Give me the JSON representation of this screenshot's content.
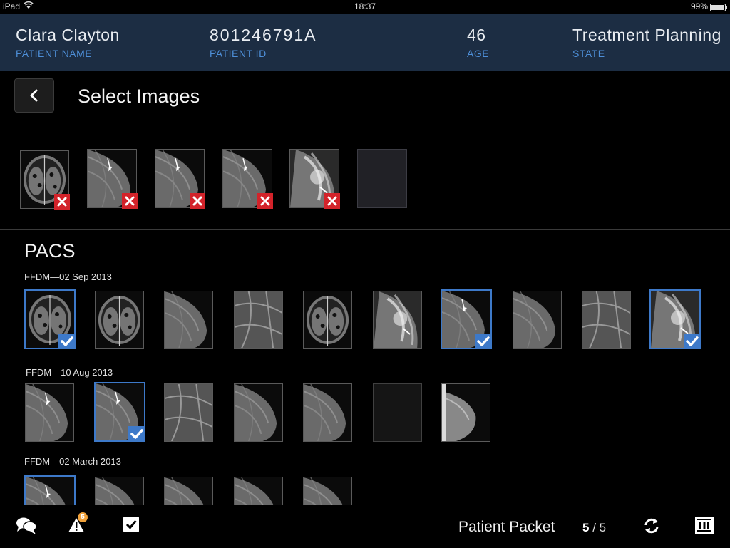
{
  "status_bar": {
    "carrier": "iPad",
    "time": "18:37",
    "battery": "99%"
  },
  "patient": {
    "name": "Clara Clayton",
    "name_label": "PATIENT NAME",
    "id": "801246791A",
    "id_label": "PATIENT ID",
    "age": "46",
    "age_label": "AGE",
    "state": "Treatment Planning",
    "state_label": "STATE"
  },
  "title": "Select Images",
  "selected_images": [
    "breast-axial-mri",
    "mammogram-arrow",
    "mammogram-arrow",
    "mammogram-arrow",
    "mammogram-dense",
    "empty"
  ],
  "pacs": {
    "title": "PACS",
    "groups": [
      {
        "label": "FFDM—02 Sep 2013",
        "images": [
          {
            "kind": "breast-axial-mri",
            "selected": true
          },
          {
            "kind": "breast-axial-mri",
            "selected": false
          },
          {
            "kind": "mammogram",
            "selected": false
          },
          {
            "kind": "mammogram-tissue",
            "selected": false
          },
          {
            "kind": "breast-axial-mri",
            "selected": false
          },
          {
            "kind": "mammogram-dense",
            "selected": false
          },
          {
            "kind": "mammogram-arrow",
            "selected": true
          },
          {
            "kind": "mammogram",
            "selected": false
          },
          {
            "kind": "mammogram-tissue",
            "selected": false
          },
          {
            "kind": "mammogram-dense",
            "selected": true
          }
        ]
      },
      {
        "label": "FFDM—10 Aug 2013",
        "images": [
          {
            "kind": "mammogram-arrow",
            "selected": false
          },
          {
            "kind": "mammogram-arrow",
            "selected": true
          },
          {
            "kind": "mammogram-tissue",
            "selected": false
          },
          {
            "kind": "mammogram",
            "selected": false
          },
          {
            "kind": "mammogram",
            "selected": false
          },
          {
            "kind": "empty",
            "selected": false
          },
          {
            "kind": "mammogram-lateral",
            "selected": false
          }
        ]
      },
      {
        "label": "FFDM—02 March 2013",
        "images": [
          {
            "kind": "mammogram-arrow",
            "selected": true
          },
          {
            "kind": "mammogram",
            "selected": false
          },
          {
            "kind": "mammogram",
            "selected": false
          },
          {
            "kind": "mammogram",
            "selected": false
          },
          {
            "kind": "mammogram",
            "selected": false
          }
        ]
      }
    ]
  },
  "bottom_bar": {
    "icons": [
      "chat-icon",
      "alert-icon",
      "checklist-icon",
      "sync-icon",
      "layout-icon"
    ],
    "alert_count": "5",
    "packet_label": "Patient Packet",
    "packet_current": "5",
    "packet_sep": "/ 5"
  },
  "colors": {
    "header_bg": "#1c2d43",
    "label_blue": "#4e8fd8",
    "select_blue": "#3d79c9",
    "remove_red": "#d3232a",
    "badge_orange": "#f0a13a"
  }
}
